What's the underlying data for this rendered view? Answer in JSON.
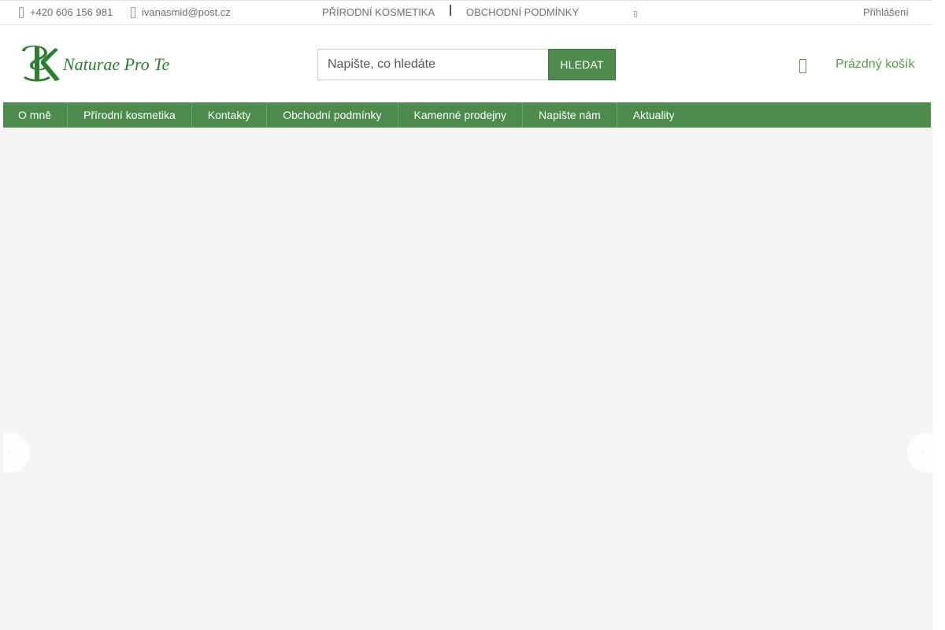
{
  "topbar": {
    "phone": "+420 606 156 981",
    "phone_icon": "phone-icon",
    "email": "ivanasmid@post.cz",
    "email_icon": "mail-icon",
    "links": [
      "PŘÍRODNÍ KOSMETIKA",
      "OBCHODNÍ PODMÍNKY"
    ],
    "login": "Přihlášení"
  },
  "header": {
    "logo_text": "Naturae Pro Te",
    "logo_monogram": "SK",
    "search_placeholder": "Napište, co hledáte",
    "search_button": "HLEDAT",
    "cart_label": "Prázdný košík",
    "cart_icon": "cart-icon"
  },
  "nav": {
    "items": [
      "O mně",
      "Přírodní kosmetika",
      "Kontakty",
      "Obchodní podmínky",
      "Kamenné prodejny",
      "Napište nám",
      "Aktuality"
    ]
  },
  "colors": {
    "brand_green": "#4c8b4c",
    "link_green": "#5a9a4f",
    "banner_bg": "#f5f5f5"
  }
}
